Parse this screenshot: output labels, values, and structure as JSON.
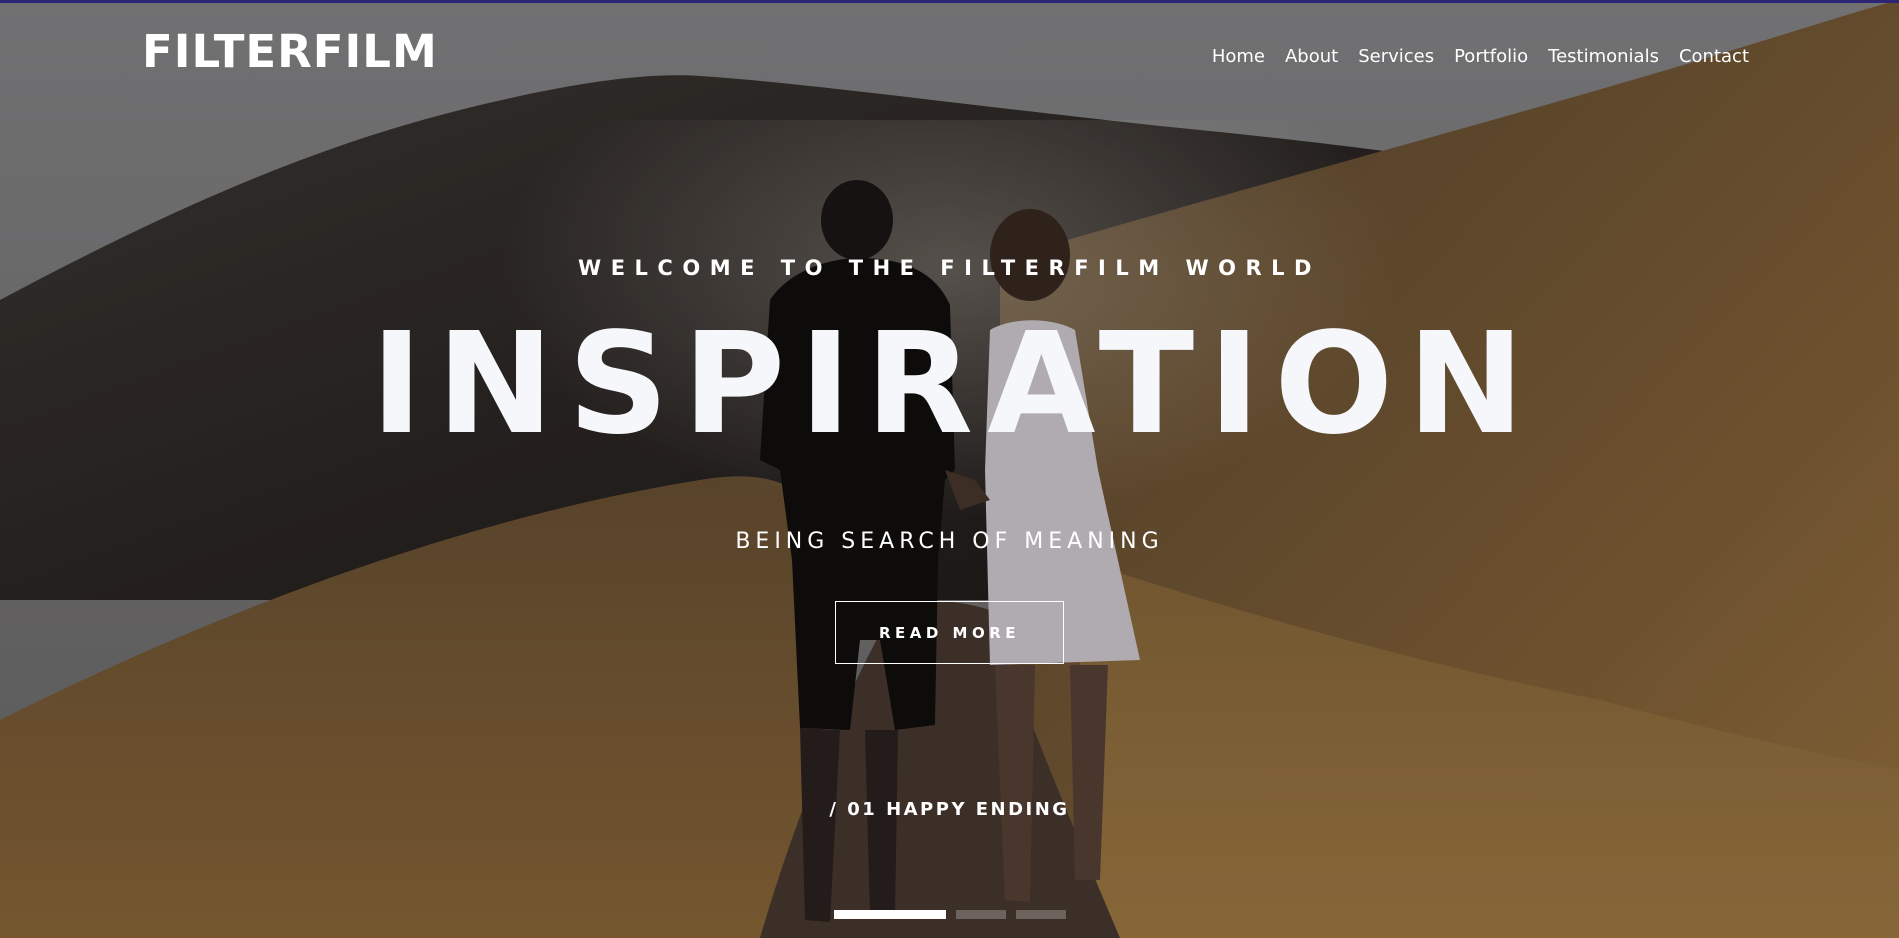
{
  "header": {
    "logo": "FILTERFILM",
    "nav": [
      {
        "label": "Home"
      },
      {
        "label": "About"
      },
      {
        "label": "Services"
      },
      {
        "label": "Portfolio"
      },
      {
        "label": "Testimonials"
      },
      {
        "label": "Contact"
      }
    ]
  },
  "hero": {
    "eyebrow": "WELCOME TO THE FILTERFILM WORLD",
    "headline": "INSPIRATION",
    "subtitle": "BEING SEARCH OF MEANING",
    "cta_label": "READ MORE",
    "slide_caption": "/ 01 HAPPY ENDING",
    "slides_total": 3,
    "active_slide": 1
  },
  "colors": {
    "accent_bar": "#2e2474",
    "text": "#ffffff",
    "headline": "#f6f7fb"
  }
}
